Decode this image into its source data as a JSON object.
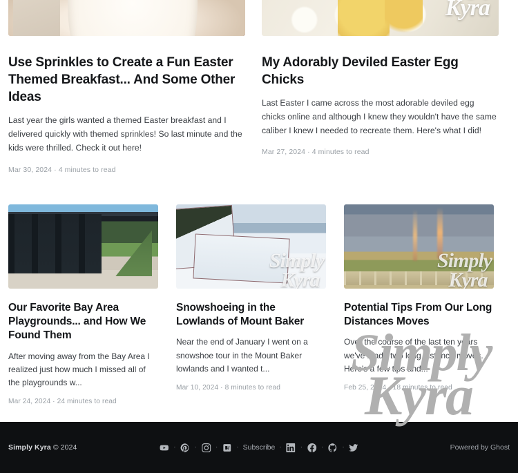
{
  "site": {
    "name": "Simply Kyra",
    "watermark_line1": "Simply",
    "watermark_line2": "Kyra"
  },
  "feed": {
    "large_posts": [
      {
        "title": "Use Sprinkles to Create a Fun Easter Themed Breakfast... And Some Other Ideas",
        "excerpt": "Last year the girls wanted a themed Easter breakfast and I delivered quickly with themed sprinkles! So last minute and the kids were thrilled. Check it out here!",
        "date": "Mar 30, 2024",
        "read_time": "4 minutes to read",
        "meta": "Mar 30, 2024 · 4 minutes to read",
        "image_alt": "breakfast-plate-photo"
      },
      {
        "title": "My Adorably Deviled Easter Egg Chicks",
        "excerpt": "Last Easter I came across the most adorable deviled egg chicks online and although I knew they wouldn't have the same caliber I knew I needed to recreate them. Here's what I did!",
        "date": "Mar 27, 2024",
        "read_time": "4 minutes to read",
        "meta": "Mar 27, 2024 · 4 minutes to read",
        "image_alt": "deviled-eggs-photo"
      }
    ],
    "small_posts": [
      {
        "title": "Our Favorite Bay Area Playgrounds... and How We Found Them",
        "excerpt": "After moving away from the Bay Area I realized just how much I missed all of the playgrounds w...",
        "date": "Mar 24, 2024",
        "read_time": "24 minutes to read",
        "meta": "Mar 24, 2024 · 24 minutes to read",
        "image_alt": "playground-structure-photo"
      },
      {
        "title": "Snowshoeing in the Lowlands of Mount Baker",
        "excerpt": "Near the end of January I went on a snowshoe tour in the Mount Baker lowlands and I wanted t...",
        "date": "Mar 10, 2024",
        "read_time": "8 minutes to read",
        "meta": "Mar 10, 2024 · 8 minutes to read",
        "image_alt": "snowy-mountain-collage-photo"
      },
      {
        "title": "Potential Tips From Our Long Distances Moves",
        "excerpt": "Over the course of the last ten years we've made two long distance moves. Here's a few tips and...",
        "date": "Feb 25, 2024",
        "read_time": "18 minutes to read",
        "meta": "Feb 25, 2024 · 18 minutes to read",
        "image_alt": "rainbow-over-road-photo"
      }
    ]
  },
  "footer": {
    "copyright_name": "Simply Kyra",
    "copyright_year": "© 2024",
    "subscribe_label": "Subscribe",
    "powered_by": "Powered by Ghost",
    "separator": "·",
    "social": [
      {
        "name": "youtube-icon",
        "label": "YouTube"
      },
      {
        "name": "pinterest-icon",
        "label": "Pinterest"
      },
      {
        "name": "instagram-icon",
        "label": "Instagram"
      },
      {
        "name": "bloglovin-icon",
        "label": "Bloglovin"
      },
      {
        "name": "linkedin-icon",
        "label": "LinkedIn"
      },
      {
        "name": "facebook-icon",
        "label": "Facebook"
      },
      {
        "name": "github-icon",
        "label": "GitHub"
      },
      {
        "name": "twitter-icon",
        "label": "Twitter"
      }
    ]
  },
  "colors": {
    "background": "#ffffff",
    "footer_background": "#0e1012",
    "heading": "#15171a",
    "body_text": "#3b3f44",
    "meta_text": "#9aa0a6",
    "watermark": "#b0b0b0"
  }
}
